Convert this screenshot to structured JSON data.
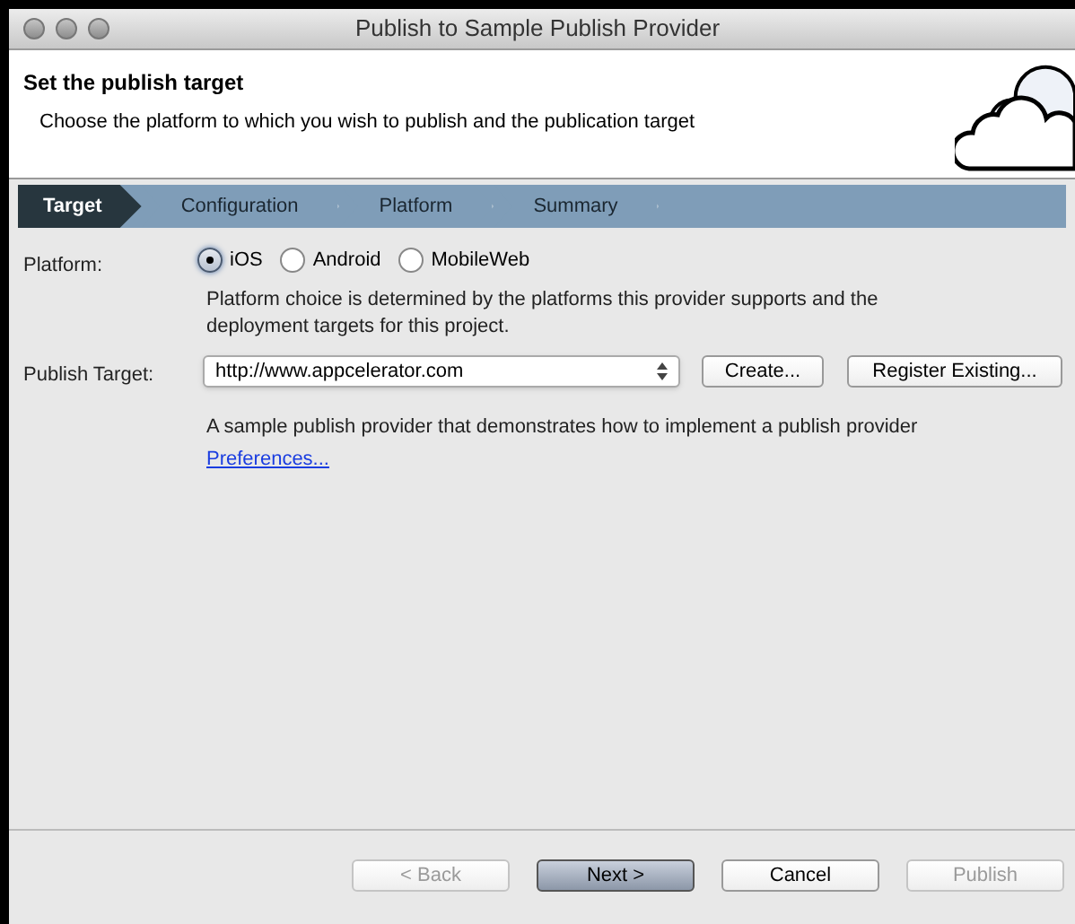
{
  "window": {
    "title": "Publish to Sample Publish Provider"
  },
  "header": {
    "title": "Set the publish target",
    "description": "Choose the platform to which you wish to publish and the publication target"
  },
  "steps": [
    {
      "label": "Target",
      "selected": true
    },
    {
      "label": "Configuration",
      "selected": false
    },
    {
      "label": "Platform",
      "selected": false
    },
    {
      "label": "Summary",
      "selected": false
    }
  ],
  "platform": {
    "label": "Platform:",
    "options": [
      {
        "label": "iOS",
        "selected": true
      },
      {
        "label": "Android",
        "selected": false
      },
      {
        "label": "MobileWeb",
        "selected": false
      }
    ],
    "note": "Platform choice is determined by the platforms this provider supports and the deployment targets for this project."
  },
  "publish_target": {
    "label": "Publish Target:",
    "value": "http://www.appcelerator.com",
    "buttons": [
      "Create...",
      "Register Existing..."
    ],
    "description": "A sample publish provider that demonstrates how to implement a publish provider",
    "link": "Preferences..."
  },
  "buttons": [
    {
      "label": "< Back",
      "kind": "normal",
      "disabled": true
    },
    {
      "label": "Next >",
      "kind": "default",
      "disabled": false
    },
    {
      "label": "Cancel",
      "kind": "normal",
      "disabled": false
    },
    {
      "label": "Publish",
      "kind": "normal",
      "disabled": true
    }
  ]
}
